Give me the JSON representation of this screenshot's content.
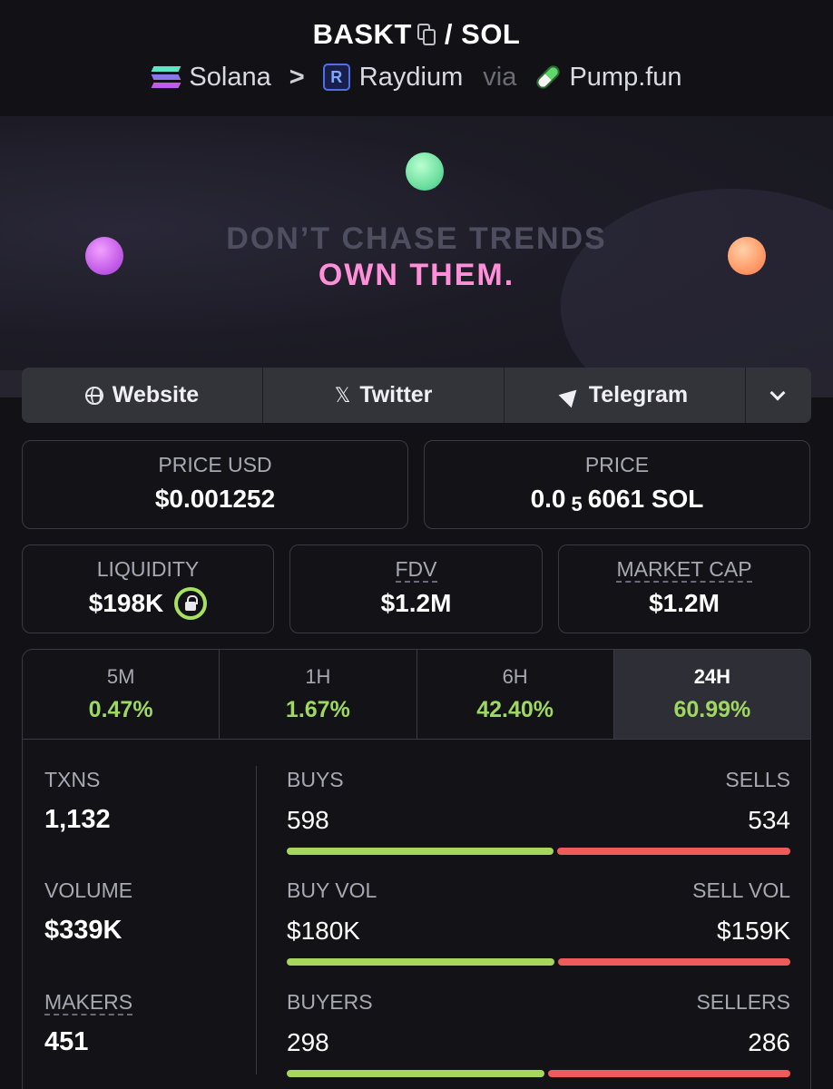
{
  "header": {
    "symbol": "BASKT",
    "slash": "/",
    "quote": "SOL",
    "chain": "Solana",
    "crumb_sep": ">",
    "dex": "Raydium",
    "via": "via",
    "launchpad": "Pump.fun"
  },
  "banner": {
    "line1": "DON’T CHASE TRENDS",
    "line2": "OWN THEM."
  },
  "links": {
    "website": "Website",
    "twitter": "Twitter",
    "telegram": "Telegram",
    "x_glyph": "𝕏"
  },
  "price": {
    "usd_label": "PRICE USD",
    "usd_value": "$0.001252",
    "native_label": "PRICE",
    "native_prefix": "0.0",
    "native_zeros": "5",
    "native_rest": "6061 SOL"
  },
  "metrics": {
    "liquidity_label": "LIQUIDITY",
    "liquidity_value": "$198K",
    "fdv_label": "FDV",
    "fdv_value": "$1.2M",
    "mcap_label": "MARKET CAP",
    "mcap_value": "$1.2M"
  },
  "timeframes": [
    {
      "label": "5M",
      "change": "0.47%"
    },
    {
      "label": "1H",
      "change": "1.67%"
    },
    {
      "label": "6H",
      "change": "42.40%"
    },
    {
      "label": "24H",
      "change": "60.99%"
    }
  ],
  "activity": {
    "txns_label": "TXNS",
    "txns_value": "1,132",
    "volume_label": "VOLUME",
    "volume_value": "$339K",
    "makers_label": "MAKERS",
    "makers_value": "451",
    "buys_label": "BUYS",
    "buys_value": "598",
    "sells_label": "SELLS",
    "sells_value": "534",
    "buy_vol_label": "BUY VOL",
    "buy_vol_value": "$180K",
    "sell_vol_label": "SELL VOL",
    "sell_vol_value": "$159K",
    "buyers_label": "BUYERS",
    "buyers_value": "298",
    "sellers_label": "SELLERS",
    "sellers_value": "286"
  },
  "colors": {
    "positive": "#9fd860",
    "buy_bar": "#a6d65c",
    "sell_bar": "#ef5a5a"
  },
  "icons": [
    "copy-icon",
    "solana-icon",
    "raydium-icon",
    "pill-icon",
    "globe-icon",
    "x-icon",
    "telegram-icon",
    "chevron-down-icon",
    "lock-icon"
  ]
}
